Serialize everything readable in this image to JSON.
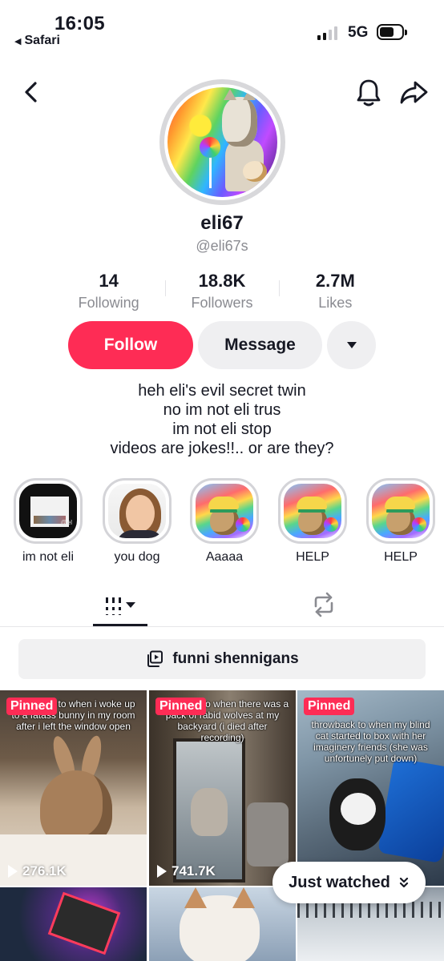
{
  "status_bar": {
    "time": "16:05",
    "back_app": "Safari",
    "network": "5G"
  },
  "profile": {
    "username": "eli67",
    "handle": "@eli67s",
    "stats": [
      {
        "value": "14",
        "label": "Following"
      },
      {
        "value": "18.8K",
        "label": "Followers"
      },
      {
        "value": "2.7M",
        "label": "Likes"
      }
    ],
    "follow_label": "Follow",
    "message_label": "Message",
    "bio": [
      "heh eli's evil secret twin",
      "no im not eli trus",
      "im not eli stop",
      "videos are jokes!!.. or are they?"
    ]
  },
  "highlights": [
    {
      "label": "im not eli"
    },
    {
      "label": "you dog"
    },
    {
      "label": "Aaaaa"
    },
    {
      "label": "HELP"
    },
    {
      "label": "HELP"
    }
  ],
  "playlist": {
    "label": "funni shennigans"
  },
  "videos": [
    {
      "pinned": "Pinned",
      "caption": "throwback to when i woke up to a fatass bunny in my room after i left the window open",
      "views": "276.1K"
    },
    {
      "pinned": "Pinned",
      "caption": "throwback to when there was a pack of rabid wolves at my backyard (i died after recording)",
      "views": "741.7K"
    },
    {
      "pinned": "Pinned",
      "caption": "throwback to when my blind cat started to box with her imaginery friends (she was unfortunely put down)",
      "views": ""
    }
  ],
  "just_watched": {
    "label": "Just watched"
  },
  "colors": {
    "accent": "#fe2c55",
    "secondary_button": "#efeff1",
    "muted_text": "#8a8b91"
  }
}
